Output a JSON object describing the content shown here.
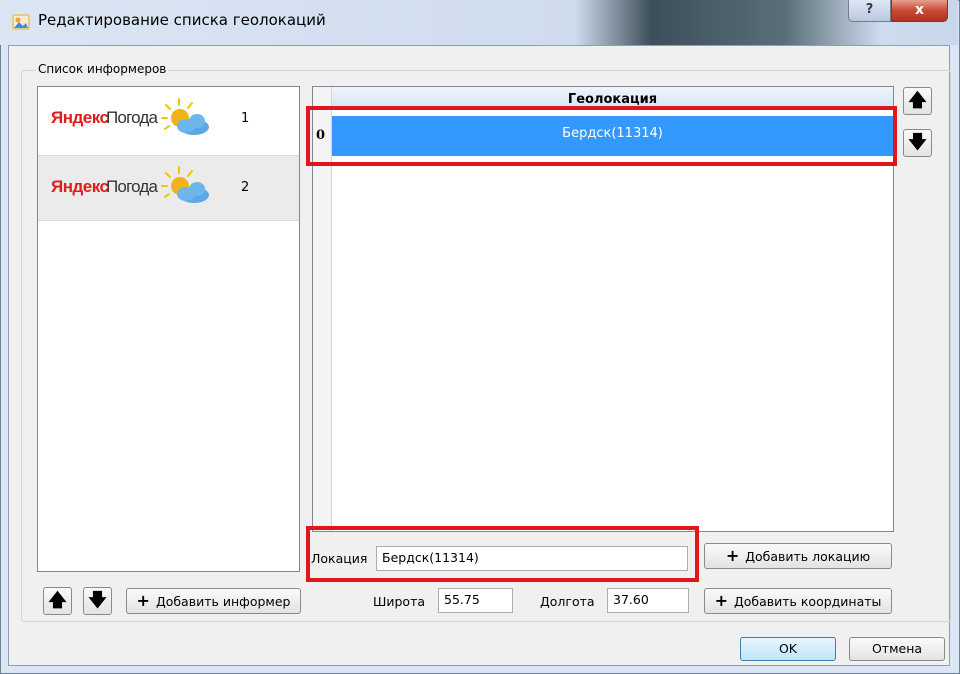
{
  "window": {
    "title": "Редактирование списка геолокаций",
    "help_label": "?",
    "close_label": "x"
  },
  "informers": {
    "group_label": "Список информеров",
    "items": [
      {
        "logo_brand": "Яндекс",
        "logo_service": "Погода",
        "number": "1"
      },
      {
        "logo_brand": "Яндекс",
        "logo_service": "Погода",
        "number": "2"
      }
    ],
    "add_label": "Добавить информер"
  },
  "table": {
    "column_header": "Геолокация",
    "rows": [
      {
        "index": "0",
        "value": "Бердск(11314)"
      }
    ]
  },
  "location": {
    "label": "Локация",
    "value": "Бердск(11314)",
    "add_label": "Добавить локацию"
  },
  "coordinates": {
    "lat_label": "Широта",
    "lat_value": "55.75",
    "lon_label": "Долгота",
    "lon_value": "37.60",
    "add_label": "Добавить координаты"
  },
  "dialog": {
    "ok_label": "OK",
    "cancel_label": "Отмена"
  },
  "icons": {
    "up": "arrow-up-icon",
    "down": "arrow-down-icon",
    "plus": "plus-icon",
    "weather": "sun-cloud-icon"
  },
  "colors": {
    "selection": "#3399ff",
    "highlight": "#e0161f"
  }
}
